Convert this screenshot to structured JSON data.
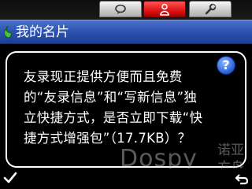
{
  "tabs": [
    {
      "icon": "speech-bubble-icon",
      "selected": false
    },
    {
      "icon": "person-icon",
      "selected": true
    },
    {
      "icon": "wrench-icon",
      "selected": false
    }
  ],
  "header": {
    "title": "我的名片"
  },
  "dialog": {
    "message": "友录现正提供方便而且免费的“友录信息”和“写新信息”独立快捷方式，是否立即下载“快捷方式增强包”（17.7KB）？"
  },
  "softkeys": {
    "left_icon": "checkmark-icon",
    "right_icon": "back-arrow-icon"
  },
  "watermark": {
    "text": "Dospy",
    "secondary": "诺亚方舟"
  },
  "colors": {
    "header": "#2a4fae",
    "selected_tab": "#e01818",
    "help_icon": "#2a64d8"
  }
}
